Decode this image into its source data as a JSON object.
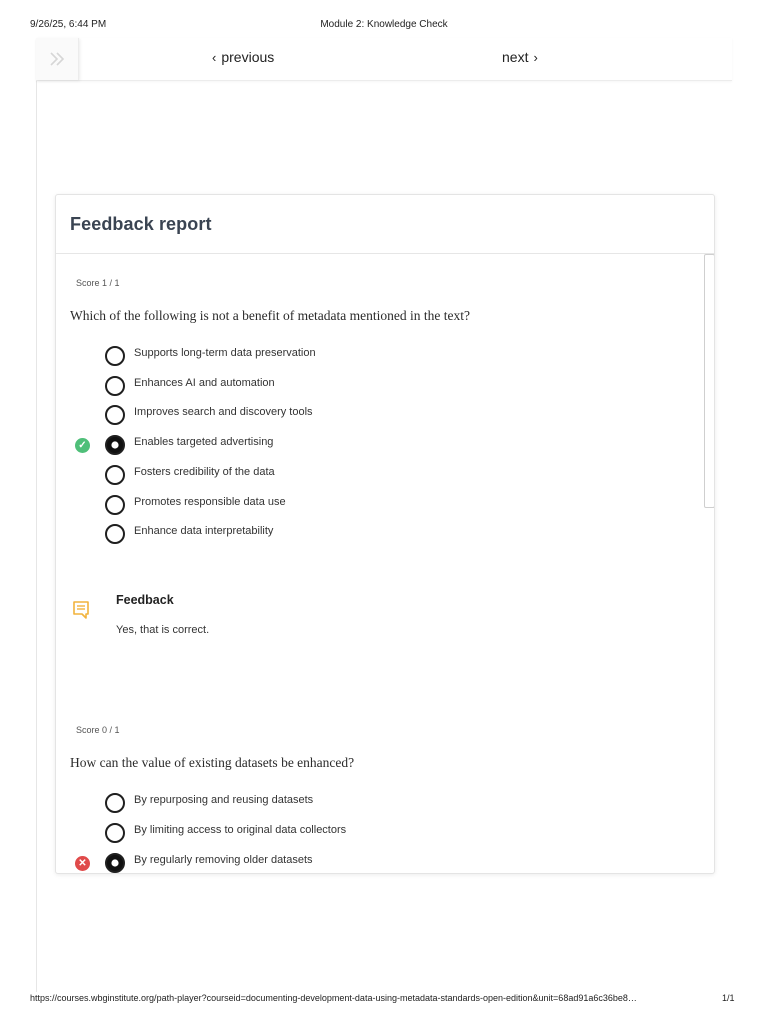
{
  "print_header": {
    "date": "9/26/25, 6:44 PM",
    "title": "Module 2: Knowledge Check"
  },
  "nav": {
    "previous_label": "previous",
    "next_label": "next"
  },
  "report": {
    "title": "Feedback report",
    "questions": [
      {
        "score": "Score 1 / 1",
        "text": "Which of the following is not a benefit of metadata mentioned in the text?",
        "options": [
          "Supports long-term data preservation",
          "Enhances AI and automation",
          "Improves search and discovery tools",
          "Enables targeted advertising",
          "Fosters credibility of the data",
          "Promotes responsible data use",
          "Enhance data interpretability"
        ],
        "selected_index": 3,
        "result": "correct"
      },
      {
        "score": "Score 0 / 1",
        "text": "How can the value of existing datasets be enhanced?",
        "options": [
          "By repurposing and reusing datasets",
          "By limiting access to original data collectors",
          "By regularly removing older datasets"
        ],
        "selected_index": 2,
        "result": "incorrect"
      }
    ],
    "feedback": {
      "title": "Feedback",
      "text": "Yes, that is correct."
    }
  },
  "colors": {
    "correct": "#4fbf79",
    "incorrect": "#e04a4a",
    "feedback_icon": "#f2b33d",
    "title": "#3a4452"
  },
  "footer": {
    "url": "https://courses.wbginstitute.org/path-player?courseid=documenting-development-data-using-metadata-standards-open-edition&unit=68ad91a6c36be8…",
    "page": "1/1"
  }
}
